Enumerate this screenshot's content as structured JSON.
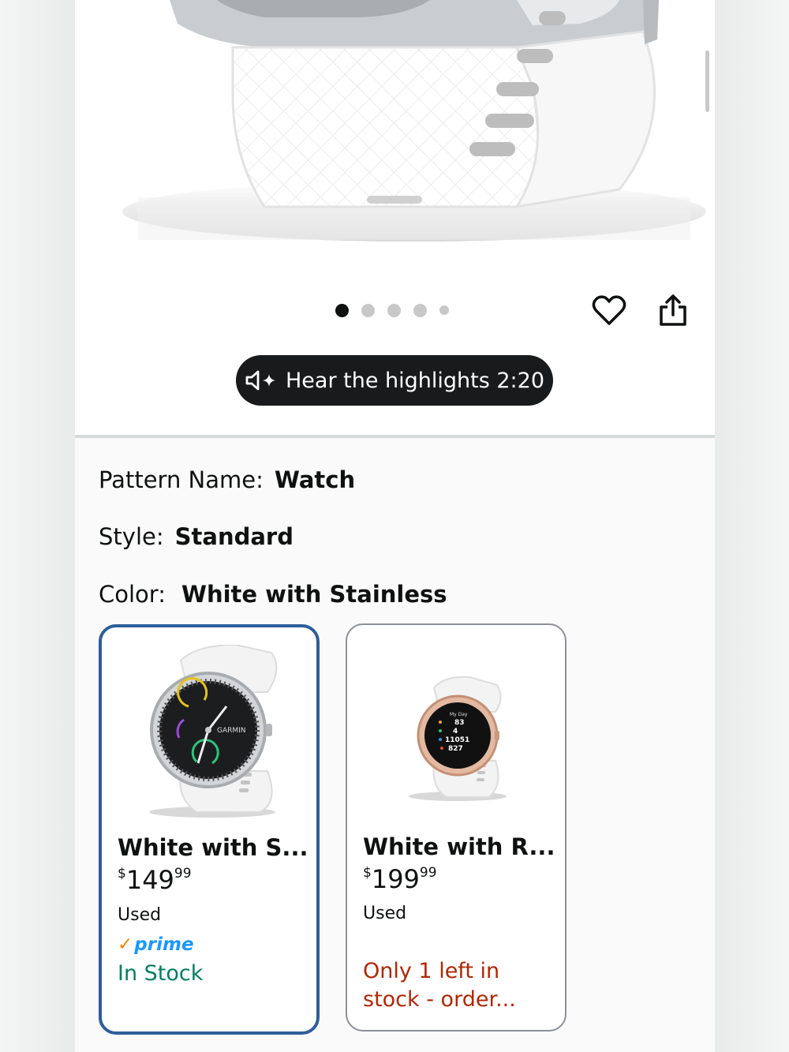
{
  "gallery": {
    "dot_count": 5,
    "active_index": 0
  },
  "actions": {
    "favorite_icon": "heart-icon",
    "share_icon": "share-icon"
  },
  "audio": {
    "label": "Hear the highlights 2:20",
    "icon": "speaker-sparkle-icon"
  },
  "options": {
    "pattern": {
      "label": "Pattern Name:",
      "value": "Watch"
    },
    "style": {
      "label": "Style:",
      "value": "Standard"
    },
    "color": {
      "label": "Color:",
      "value": "White with Stainless"
    }
  },
  "variants": [
    {
      "title": "White with S...",
      "price_whole": "149",
      "price_fraction": "99",
      "currency": "$",
      "condition": "Used",
      "prime": "prime",
      "availability": "In Stock",
      "selected": true,
      "watch_face": {
        "brand": "GARMIN"
      }
    },
    {
      "title": "White with R...",
      "price_whole": "199",
      "price_fraction": "99",
      "currency": "$",
      "condition": "Used",
      "availability": "Only 1 left in stock - order...",
      "selected": false,
      "watch_face": {
        "header": "My Day",
        "lines": [
          "83",
          "4",
          "11051",
          "827"
        ]
      }
    }
  ],
  "colors": {
    "selected_border": "#2e5e99",
    "in_stock": "#067d62",
    "low_stock": "#b12704",
    "prime_blue": "#1a98ff",
    "prime_check": "#f08804"
  }
}
